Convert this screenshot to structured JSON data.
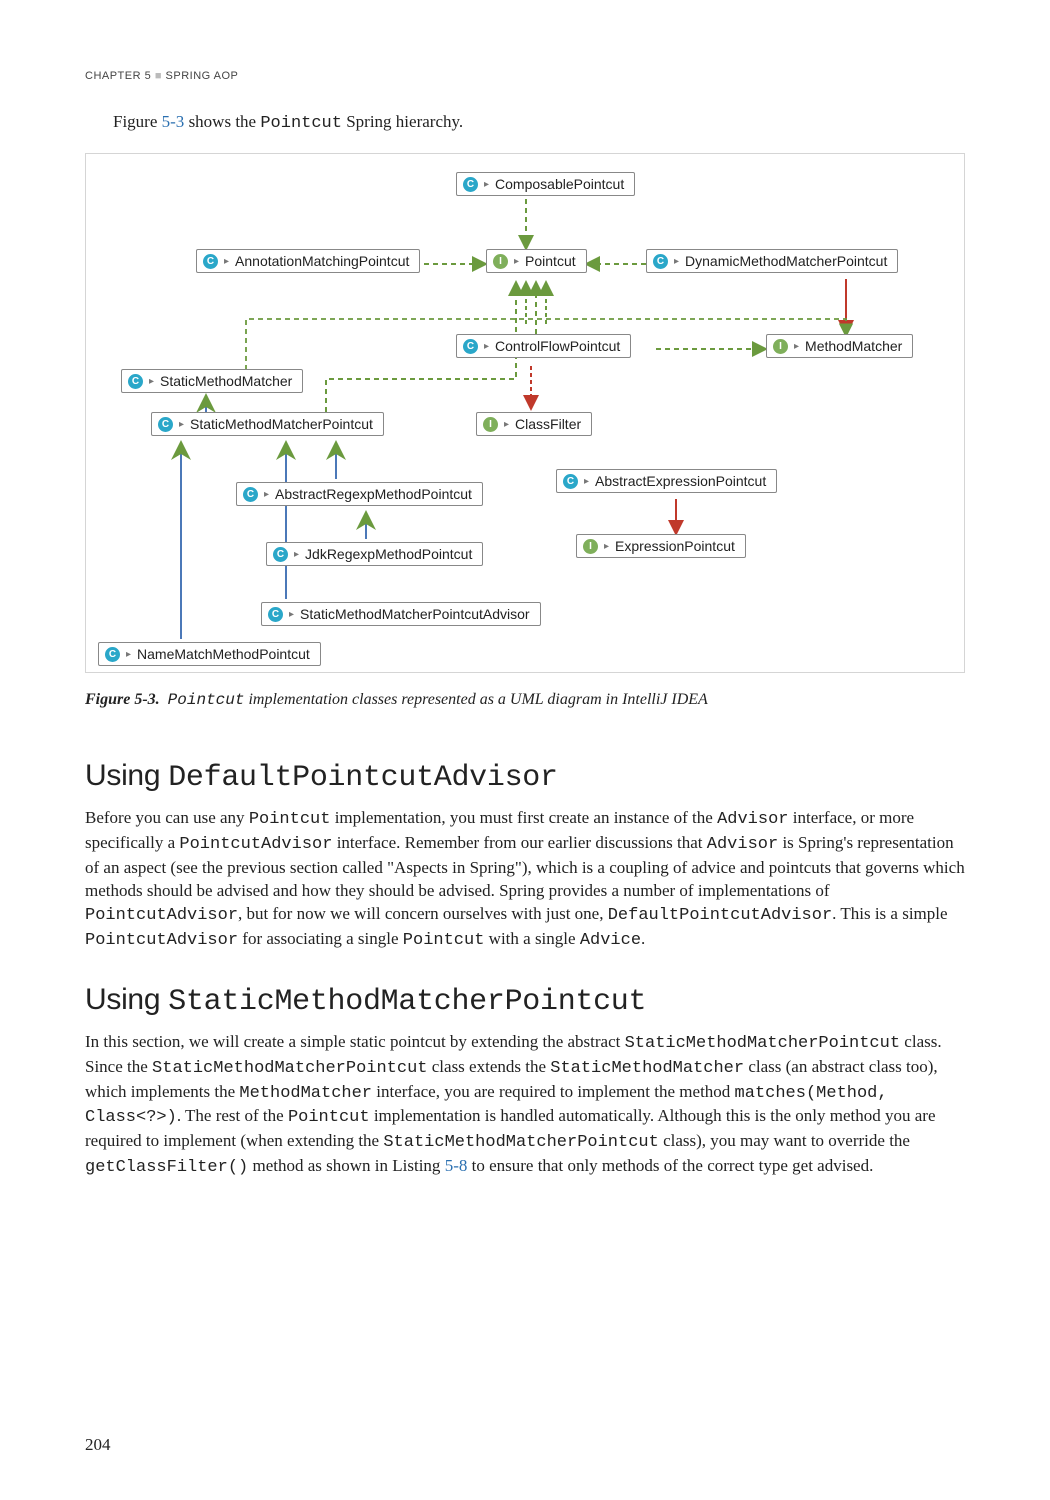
{
  "header": {
    "chapter_label": "CHAPTER 5",
    "chapter_title": "SPRING AOP"
  },
  "intro": {
    "pre": "Figure ",
    "ref": "5-3",
    "mid": " shows the ",
    "code": "Pointcut",
    "post": " Spring hierarchy."
  },
  "diagram": {
    "nodes": {
      "composable": "ComposablePointcut",
      "annotation": "AnnotationMatchingPointcut",
      "pointcut": "Pointcut",
      "dynamic": "DynamicMethodMatcherPointcut",
      "controlflow": "ControlFlowPointcut",
      "methodmatcher": "MethodMatcher",
      "staticmm": "StaticMethodMatcher",
      "staticmmp": "StaticMethodMatcherPointcut",
      "classfilter": "ClassFilter",
      "abstractregexp": "AbstractRegexpMethodPointcut",
      "abstractexpr": "AbstractExpressionPointcut",
      "jdkregexp": "JdkRegexpMethodPointcut",
      "exprpointcut": "ExpressionPointcut",
      "staticadvisor": "StaticMethodMatcherPointcutAdvisor",
      "namematch": "NameMatchMethodPointcut"
    }
  },
  "caption": {
    "label": "Figure 5-3.",
    "code": "Pointcut",
    "rest": " implementation classes represented as a UML diagram in IntelliJ IDEA"
  },
  "section1": {
    "heading_plain": "Using ",
    "heading_code": "DefaultPointcutAdvisor",
    "body_html": "Before you can use any <span class='mono'>Pointcut</span> implementation, you must first create an instance of the <span class='mono'>Advisor</span> interface, or more specifically a <span class='mono'>PointcutAdvisor</span> interface. Remember from our earlier discussions that <span class='mono'>Advisor</span> is Spring's representation of an aspect (see the previous section called \"Aspects in Spring\"), which is a coupling of advice and pointcuts that governs which methods should be advised and how they should be advised. Spring provides a number of implementations of <span class='mono'>PointcutAdvisor</span>, but for now we will concern ourselves with just one, <span class='mono'>DefaultPointcutAdvisor</span>. This is a simple <span class='mono'>PointcutAdvisor</span> for associating a single <span class='mono'>Pointcut</span> with a single <span class='mono'>Advice</span>."
  },
  "section2": {
    "heading_plain": "Using ",
    "heading_code": "StaticMethodMatcherPointcut",
    "body_html": "In this section, we will create a simple static pointcut by extending the abstract <span class='mono'>StaticMethodMatcherPointcut</span> class. Since the <span class='mono'>StaticMethodMatcherPointcut</span> class extends the <span class='mono'>StaticMethodMatcher</span> class (an abstract class too), which implements the <span class='mono'>MethodMatcher</span> interface, you are required to implement the method <span class='mono'>matches(Method, Class&lt;?&gt;)</span>. The rest of the <span class='mono'>Pointcut</span> implementation is handled automatically. Although this is the only method you are required to implement (when extending the <span class='mono'>StaticMethodMatcherPointcut</span> class), you may want to override the <span class='mono'>getClassFilter()</span> method as shown in Listing <span class='listing-ref'>5-8</span> to ensure that only methods of the correct type get advised."
  },
  "page_number": "204",
  "chart_data": {
    "type": "diagram",
    "description": "UML class hierarchy for Spring Pointcut interface",
    "nodes": [
      {
        "id": "Pointcut",
        "kind": "interface"
      },
      {
        "id": "ComposablePointcut",
        "kind": "class"
      },
      {
        "id": "AnnotationMatchingPointcut",
        "kind": "class"
      },
      {
        "id": "DynamicMethodMatcherPointcut",
        "kind": "class"
      },
      {
        "id": "ControlFlowPointcut",
        "kind": "class"
      },
      {
        "id": "MethodMatcher",
        "kind": "interface"
      },
      {
        "id": "StaticMethodMatcher",
        "kind": "class"
      },
      {
        "id": "StaticMethodMatcherPointcut",
        "kind": "class"
      },
      {
        "id": "ClassFilter",
        "kind": "interface"
      },
      {
        "id": "AbstractRegexpMethodPointcut",
        "kind": "class"
      },
      {
        "id": "AbstractExpressionPointcut",
        "kind": "class"
      },
      {
        "id": "JdkRegexpMethodPointcut",
        "kind": "class"
      },
      {
        "id": "ExpressionPointcut",
        "kind": "interface"
      },
      {
        "id": "StaticMethodMatcherPointcutAdvisor",
        "kind": "class"
      },
      {
        "id": "NameMatchMethodPointcut",
        "kind": "class"
      }
    ],
    "edges": [
      {
        "from": "ComposablePointcut",
        "to": "Pointcut",
        "type": "implements"
      },
      {
        "from": "AnnotationMatchingPointcut",
        "to": "Pointcut",
        "type": "implements"
      },
      {
        "from": "DynamicMethodMatcherPointcut",
        "to": "Pointcut",
        "type": "implements"
      },
      {
        "from": "ControlFlowPointcut",
        "to": "Pointcut",
        "type": "implements"
      },
      {
        "from": "ControlFlowPointcut",
        "to": "MethodMatcher",
        "type": "implements"
      },
      {
        "from": "StaticMethodMatcherPointcut",
        "to": "StaticMethodMatcher",
        "type": "extends"
      },
      {
        "from": "StaticMethodMatcherPointcut",
        "to": "Pointcut",
        "type": "implements"
      },
      {
        "from": "StaticMethodMatcher",
        "to": "MethodMatcher",
        "type": "implements"
      },
      {
        "from": "Pointcut",
        "to": "ClassFilter",
        "type": "uses"
      },
      {
        "from": "AbstractRegexpMethodPointcut",
        "to": "StaticMethodMatcherPointcut",
        "type": "extends"
      },
      {
        "from": "JdkRegexpMethodPointcut",
        "to": "AbstractRegexpMethodPointcut",
        "type": "extends"
      },
      {
        "from": "StaticMethodMatcherPointcutAdvisor",
        "to": "StaticMethodMatcherPointcut",
        "type": "extends"
      },
      {
        "from": "NameMatchMethodPointcut",
        "to": "StaticMethodMatcherPointcut",
        "type": "extends"
      },
      {
        "from": "AbstractExpressionPointcut",
        "to": "ExpressionPointcut",
        "type": "implements"
      },
      {
        "from": "ExpressionPointcut",
        "to": "Pointcut",
        "type": "extends"
      }
    ]
  }
}
